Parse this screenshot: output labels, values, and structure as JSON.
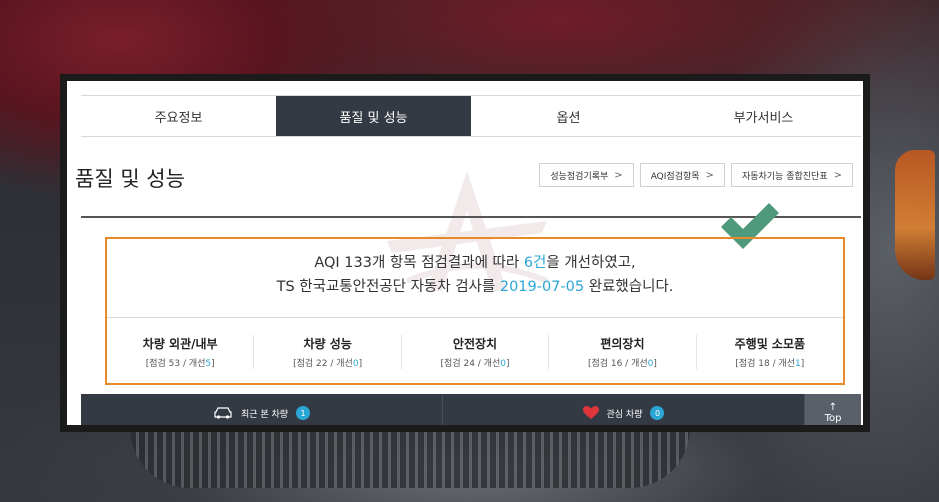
{
  "tabs": [
    {
      "label": "주요정보",
      "active": false
    },
    {
      "label": "품질 및 성능",
      "active": true
    },
    {
      "label": "옵션",
      "active": false
    },
    {
      "label": "부가서비스",
      "active": false
    }
  ],
  "section": {
    "title": "품질 및 성능",
    "links": [
      {
        "label": "성능점검기록부"
      },
      {
        "label": "AQI점검항목"
      },
      {
        "label": "자동차기능 종합진단표"
      }
    ]
  },
  "summary": {
    "line1_pre": "AQI 133개 항목 점검결과에 따라 ",
    "line1_highlight": "6건",
    "line1_post": "을 개선하였고,",
    "line2_pre": "TS 한국교통안전공단 자동차 검사를 ",
    "line2_highlight": "2019-07-05",
    "line2_post": " 완료했습니다."
  },
  "categories": [
    {
      "name": "차량 외관/내부",
      "count_pre": "[점검 53 / 개선",
      "improved": "5",
      "count_post": "]"
    },
    {
      "name": "차량 성능",
      "count_pre": "[점검 22 / 개선",
      "improved": "0",
      "count_post": "]"
    },
    {
      "name": "안전장치",
      "count_pre": "[점검 24 / 개선",
      "improved": "0",
      "count_post": "]"
    },
    {
      "name": "편의장치",
      "count_pre": "[점검 16 / 개선",
      "improved": "0",
      "count_post": "]"
    },
    {
      "name": "주행및 소모품",
      "count_pre": "[점검 18 / 개선",
      "improved": "1",
      "count_post": "]"
    }
  ],
  "bottombar": {
    "recent": {
      "label": "최근 본 차량",
      "count": "1"
    },
    "favorite": {
      "label": "관심 차량",
      "count": "0"
    },
    "top": {
      "arrow": "↑",
      "label": "Top"
    }
  },
  "colors": {
    "accent_blue": "#2aa6d6",
    "box_orange": "#e8892a",
    "dark_bar": "#343a44",
    "check_green": "#4f9a7c",
    "heart_red": "#e0353b"
  }
}
